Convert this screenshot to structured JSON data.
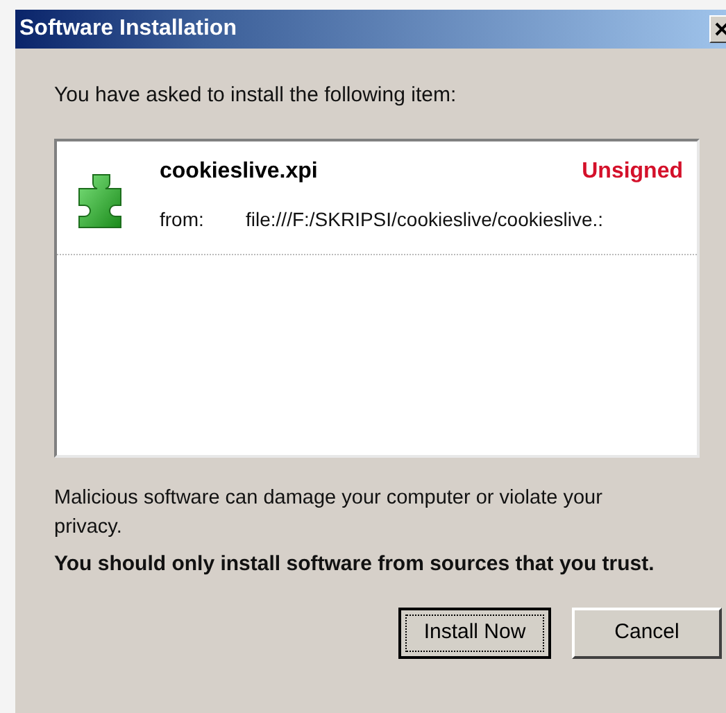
{
  "window": {
    "title": "Software Installation"
  },
  "intro": "You have asked to install the following item:",
  "items": [
    {
      "name": "cookieslive.xpi",
      "status": "Unsigned",
      "from_label": "from:",
      "from": "file:///F:/SKRIPSI/cookieslive/cookieslive.:"
    }
  ],
  "warning": "Malicious software can damage your computer or violate your privacy.",
  "advice": "You should only install software from sources that you trust.",
  "buttons": [
    {
      "label": "Install Now",
      "default": true
    },
    {
      "label": "Cancel",
      "default": false
    }
  ]
}
